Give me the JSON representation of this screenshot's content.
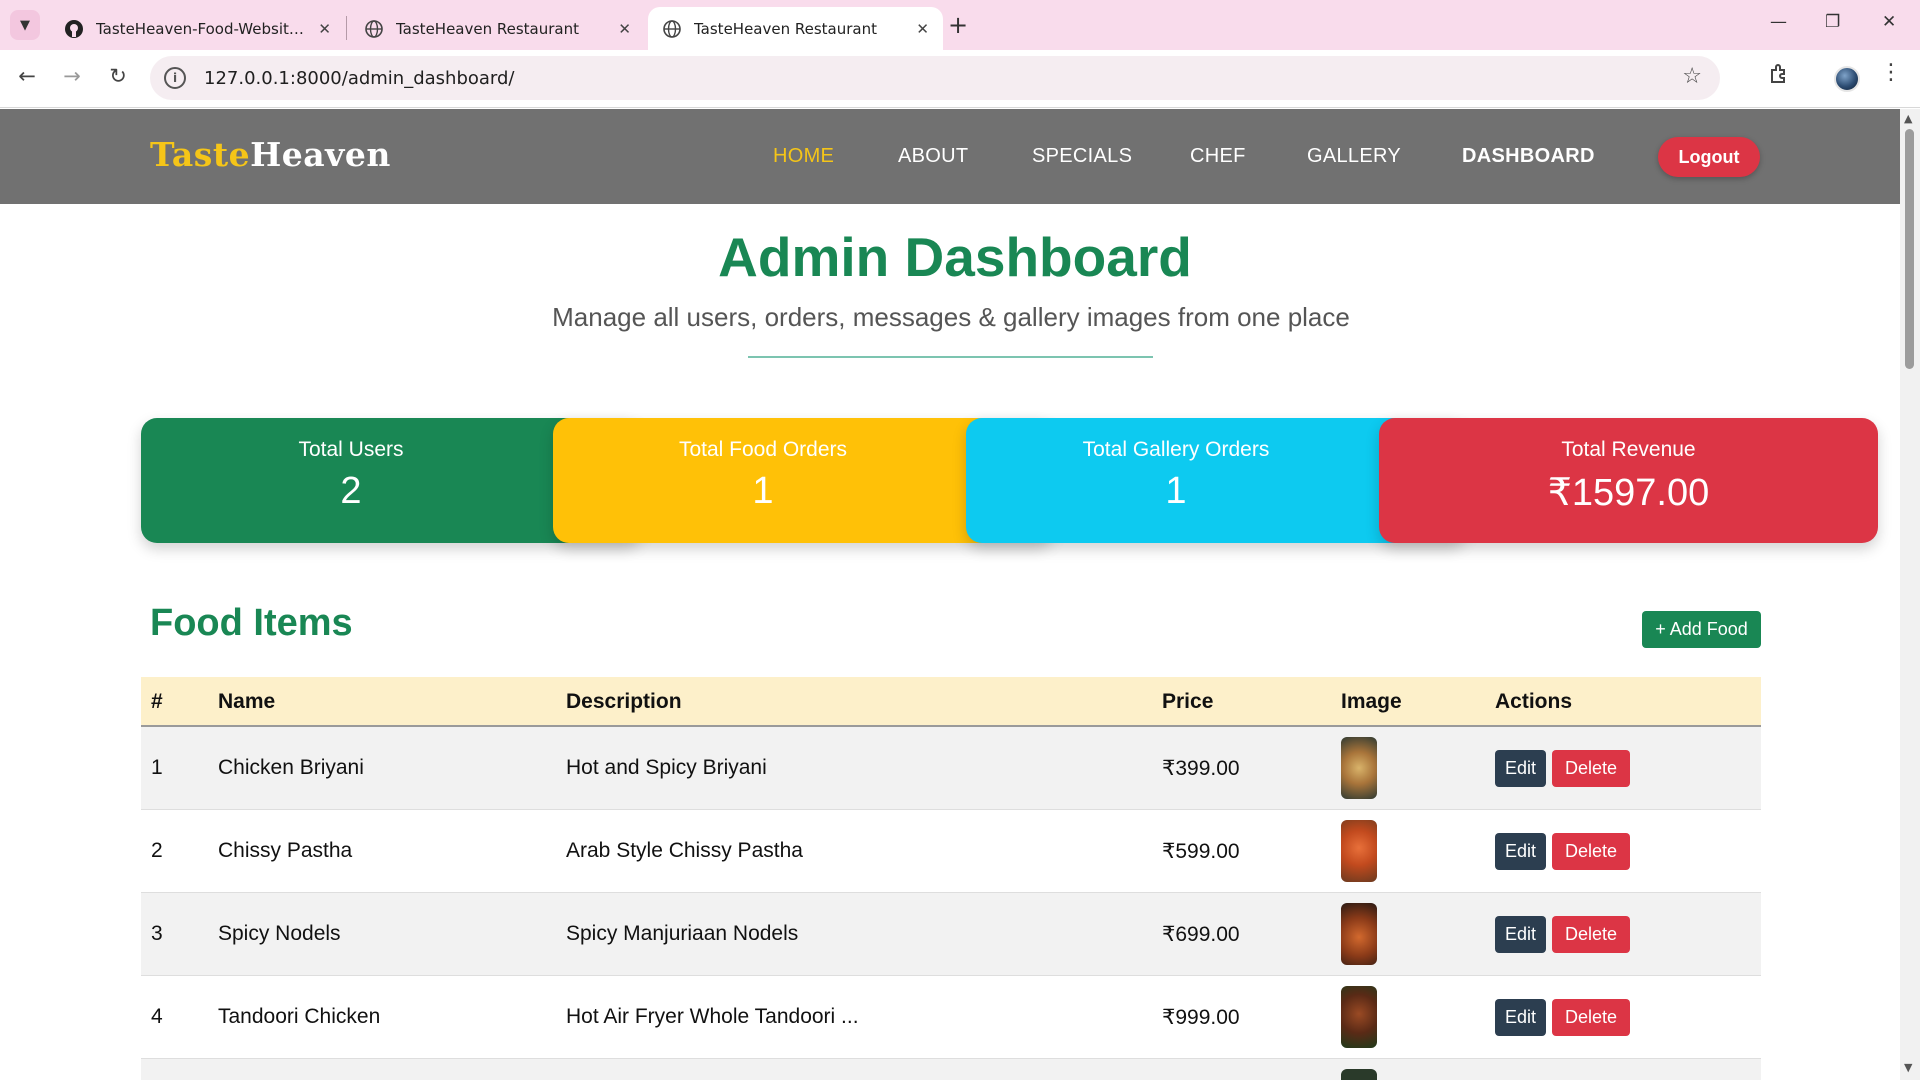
{
  "browser": {
    "tabs": [
      {
        "title": "TasteHeaven-Food-Website-In-Django",
        "icon": "github-icon"
      },
      {
        "title": "TasteHeaven Restaurant",
        "icon": "globe-icon"
      },
      {
        "title": "TasteHeaven Restaurant",
        "icon": "globe-icon",
        "active": true
      }
    ],
    "url": "127.0.0.1:8000/admin_dashboard/"
  },
  "site": {
    "logo_part1": "Taste",
    "logo_part2": "Heaven",
    "nav": [
      "HOME",
      "ABOUT",
      "SPECIALS",
      "CHEF",
      "GALLERY",
      "DASHBOARD"
    ],
    "active_nav": "HOME",
    "logout_label": "Logout"
  },
  "hero": {
    "title": "Admin Dashboard",
    "subtitle": "Manage all users, orders, messages & gallery images from one place"
  },
  "stats": [
    {
      "label": "Total Users",
      "value": "2",
      "color": "#198754"
    },
    {
      "label": "Total Food Orders",
      "value": "1",
      "color": "#ffc107"
    },
    {
      "label": "Total Gallery Orders",
      "value": "1",
      "color": "#0dcaf0"
    },
    {
      "label": "Total Revenue",
      "value": "₹1597.00",
      "color": "#dc3545"
    }
  ],
  "food_section": {
    "title": "Food Items",
    "add_label": "+ Add Food",
    "columns": [
      "#",
      "Name",
      "Description",
      "Price",
      "Image",
      "Actions"
    ],
    "edit_label": "Edit",
    "delete_label": "Delete",
    "rows": [
      {
        "num": "1",
        "name": "Chicken Briyani",
        "description": "Hot and Spicy Briyani",
        "price": "₹399.00"
      },
      {
        "num": "2",
        "name": "Chissy Pastha",
        "description": "Arab Style Chissy Pastha",
        "price": "₹599.00"
      },
      {
        "num": "3",
        "name": "Spicy Nodels",
        "description": "Spicy Manjuriaan Nodels",
        "price": "₹699.00"
      },
      {
        "num": "4",
        "name": "Tandoori Chicken",
        "description": "Hot Air Fryer Whole Tandoori ...",
        "price": "₹999.00"
      }
    ]
  },
  "colors": {
    "brand_green": "#198754",
    "header_gray": "#717171",
    "logo_gold": "#f5c518",
    "danger": "#dc3545",
    "dark_btn": "#2c3e50"
  }
}
